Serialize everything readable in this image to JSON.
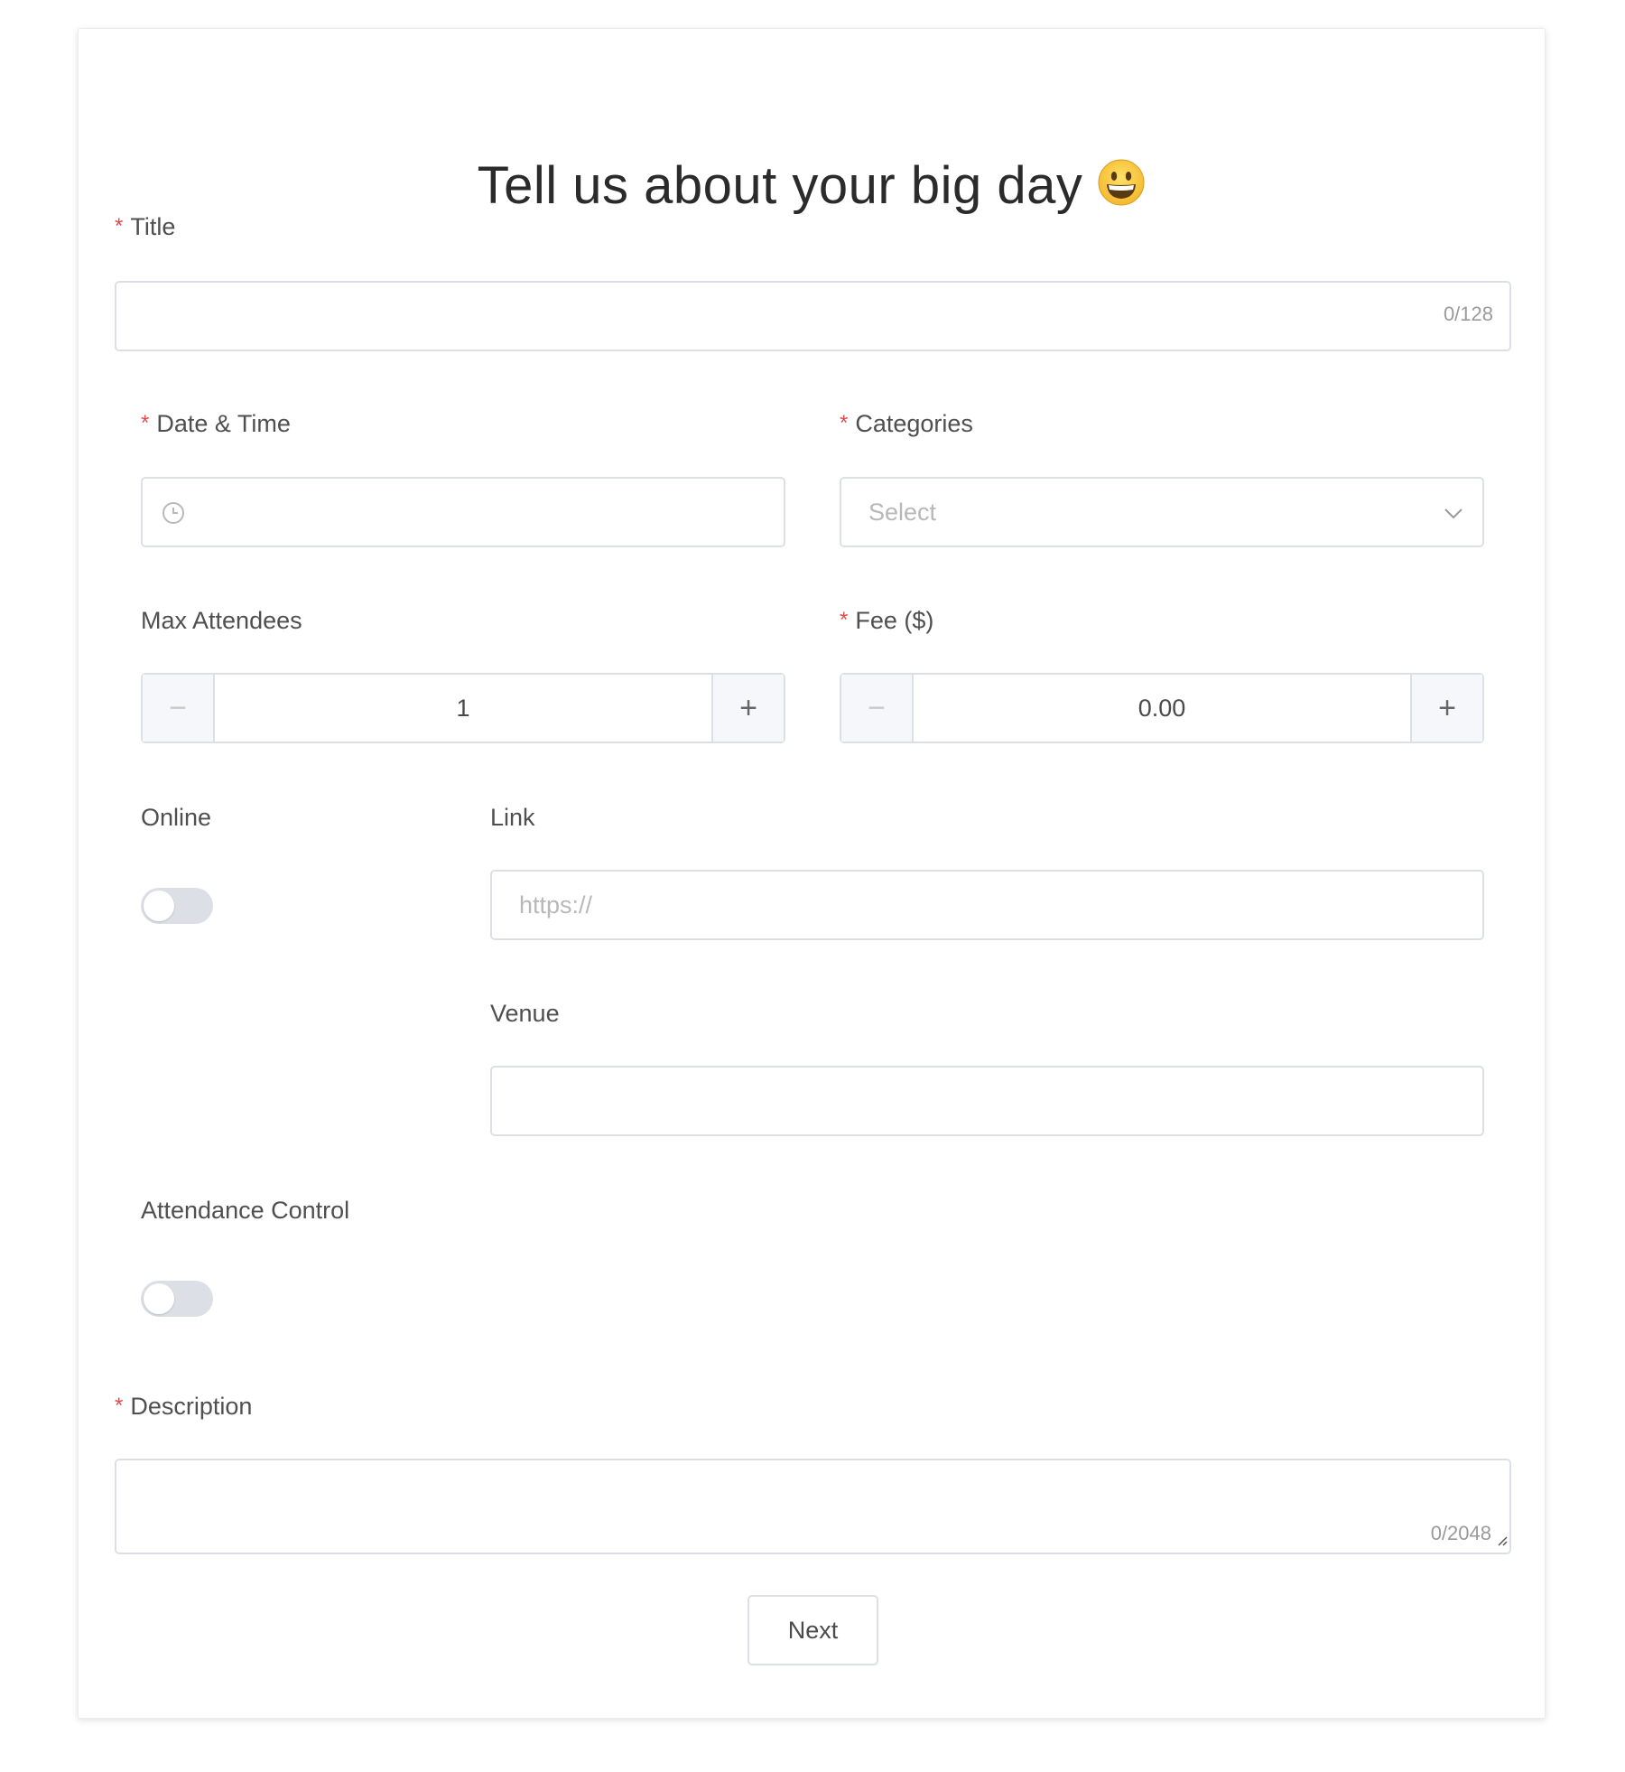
{
  "form": {
    "heading": "Tell us about your big day",
    "heading_emoji": "grinning-face-emoji",
    "fields": {
      "title": {
        "label": "Title",
        "required": true,
        "value": "",
        "counter": "0/128"
      },
      "date_time": {
        "label": "Date & Time",
        "required": true,
        "value": "",
        "icon": "clock-icon"
      },
      "categories": {
        "label": "Categories",
        "required": true,
        "placeholder": "Select",
        "icon": "chevron-down-icon"
      },
      "max_attendees": {
        "label": "Max Attendees",
        "required": false,
        "value": "1",
        "minus": "−",
        "plus": "+"
      },
      "fee": {
        "label": "Fee ($)",
        "required": true,
        "value": "0.00",
        "minus": "−",
        "plus": "+"
      },
      "online": {
        "label": "Online",
        "checked": false
      },
      "link": {
        "label": "Link",
        "placeholder": "https://",
        "value": ""
      },
      "venue": {
        "label": "Venue",
        "value": ""
      },
      "attendance_control": {
        "label": "Attendance Control",
        "checked": false
      },
      "description": {
        "label": "Description",
        "required": true,
        "value": "",
        "counter": "0/2048"
      }
    },
    "required_marker": "*",
    "next_button": "Next"
  },
  "colors": {
    "required": "#e24b4b",
    "border": "#dcdfe6",
    "toggle_off": "#dcdfe6",
    "addon_bg": "#f5f7fa"
  }
}
